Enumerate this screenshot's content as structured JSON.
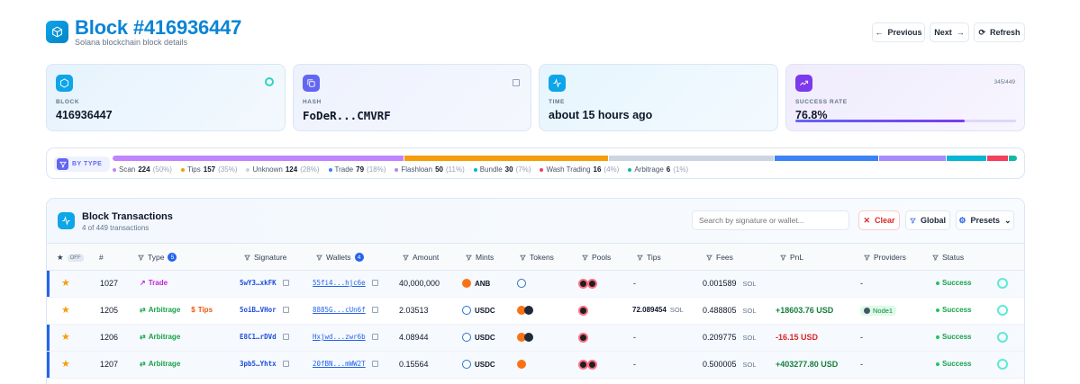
{
  "header": {
    "title": "Block #416936447",
    "subtitle": "Solana blockchain block details",
    "prev_label": "Previous",
    "next_label": "Next",
    "refresh_label": "Refresh"
  },
  "cards": {
    "block": {
      "label": "BLOCK",
      "value": "416936447"
    },
    "hash": {
      "label": "HASH",
      "value": "FoDeR...CMVRF"
    },
    "time": {
      "label": "TIME",
      "value": "about 15 hours ago"
    },
    "success": {
      "label": "SUCCESS RATE",
      "value": "76.8%",
      "count": "345/449",
      "rate": 0.768
    }
  },
  "by_type": {
    "label": "BY TYPE",
    "segments": [
      {
        "name": "Scan",
        "count": "224",
        "pct": "(50%)",
        "color": "#c084fc",
        "frac": 0.3
      },
      {
        "name": "Tips",
        "count": "157",
        "pct": "(35%)",
        "color": "#f59e0b",
        "frac": 0.21
      },
      {
        "name": "Unknown",
        "count": "124",
        "pct": "(28%)",
        "color": "#cbd5e1",
        "frac": 0.17
      },
      {
        "name": "Trade",
        "count": "79",
        "pct": "(18%)",
        "color": "#3b82f6",
        "frac": 0.107
      },
      {
        "name": "Flashloan",
        "count": "50",
        "pct": "(11%)",
        "color": "#a78bfa",
        "frac": 0.068
      },
      {
        "name": "Bundle",
        "count": "30",
        "pct": "(7%)",
        "color": "#06b6d4",
        "frac": 0.041
      },
      {
        "name": "Wash Trading",
        "count": "16",
        "pct": "(4%)",
        "color": "#f43f5e",
        "frac": 0.022
      },
      {
        "name": "Arbitrage",
        "count": "6",
        "pct": "(1%)",
        "color": "#14b8a6",
        "frac": 0.008
      }
    ]
  },
  "transactions": {
    "title": "Block Transactions",
    "subtitle": "4 of 449 transactions",
    "search_placeholder": "Search by signature or wallet...",
    "clear_label": "Clear",
    "global_label": "Global",
    "presets_label": "Presets",
    "off_label": "OFF",
    "columns": {
      "num": "#",
      "type": "Type",
      "type_badge": "5",
      "signature": "Signature",
      "wallets": "Wallets",
      "wallets_badge": "4",
      "amount": "Amount",
      "mints": "Mints",
      "tokens": "Tokens",
      "pools": "Pools",
      "tips": "Tips",
      "fees": "Fees",
      "pnl": "PnL",
      "providers": "Providers",
      "status": "Status"
    },
    "rows": [
      {
        "num": "1027",
        "type": "Trade",
        "type_color": "#c026d3",
        "extra_type": "",
        "signature": "5wY3…xkFK",
        "wallet": "55fi4...hjc6e",
        "amount": "40,000,000",
        "mint": "ANB",
        "tips": "-",
        "tips_unit": "",
        "fees": "0.001589",
        "fees_unit": "SOL",
        "pnl": "",
        "pnl_color": "#0f172a",
        "provider": "-",
        "status": "Success"
      },
      {
        "num": "1205",
        "type": "Arbitrage",
        "type_color": "#16a34a",
        "extra_type": "Tips",
        "signature": "5oiB…VHor",
        "wallet": "8885G...cUn6f",
        "amount": "2.03513",
        "mint": "USDC",
        "tips": "72.089454",
        "tips_unit": "SOL",
        "fees": "0.488805",
        "fees_unit": "SOL",
        "pnl": "+18603.76 USD",
        "pnl_color": "#15803d",
        "provider": "Node1",
        "status": "Success"
      },
      {
        "num": "1206",
        "type": "Arbitrage",
        "type_color": "#16a34a",
        "extra_type": "",
        "signature": "E8C1…rDVd",
        "wallet": "Hxjwd...zwr6b",
        "amount": "4.08944",
        "mint": "USDC",
        "tips": "-",
        "tips_unit": "",
        "fees": "0.209775",
        "fees_unit": "SOL",
        "pnl": "-16.15 USD",
        "pnl_color": "#dc2626",
        "provider": "-",
        "status": "Success"
      },
      {
        "num": "1207",
        "type": "Arbitrage",
        "type_color": "#16a34a",
        "extra_type": "",
        "signature": "3pb5…Yhtx",
        "wallet": "20fBN...mWW2T",
        "amount": "0.15564",
        "mint": "USDC",
        "tips": "-",
        "tips_unit": "",
        "fees": "0.500005",
        "fees_unit": "SOL",
        "pnl": "+403277.80 USD",
        "pnl_color": "#15803d",
        "provider": "-",
        "status": "Success"
      }
    ]
  }
}
